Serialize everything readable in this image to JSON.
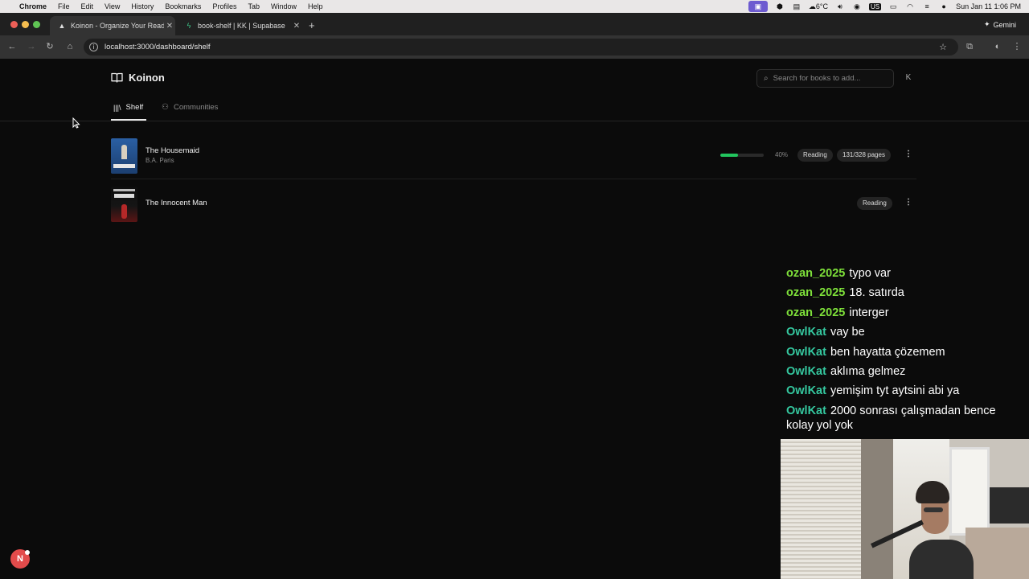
{
  "menubar": {
    "app": "Chrome",
    "items": [
      "File",
      "Edit",
      "View",
      "History",
      "Bookmarks",
      "Profiles",
      "Tab",
      "Window",
      "Help"
    ],
    "weather": "6°C",
    "input_source": "US",
    "datetime": "Sun Jan 11  1:06 PM"
  },
  "browser": {
    "tabs": [
      {
        "title": "Koinon - Organize Your Readi",
        "active": true
      },
      {
        "title": "book-shelf | KK | Supabase",
        "active": false
      }
    ],
    "gemini_label": "Gemini",
    "url": "localhost:3000/dashboard/shelf"
  },
  "app": {
    "brand": "Koinon",
    "search_placeholder": "Search for books to add...",
    "avatar_initial": "K",
    "nav": [
      {
        "label": "Shelf",
        "active": true
      },
      {
        "label": "Communities",
        "active": false
      }
    ]
  },
  "books": [
    {
      "title": "The Housemaid",
      "author": "B.A. Paris",
      "progress": 0.4,
      "percent_label": "40%",
      "status": "Reading",
      "pages_label": "131/328 pages",
      "cover_color": "#1e4f8c"
    },
    {
      "title": "The Innocent Man",
      "author": "",
      "status": "Reading",
      "cover_color": "#1a1a1a"
    }
  ],
  "chat": [
    {
      "user": "ozan_2025",
      "color": "#7ee03a",
      "message": "typo var"
    },
    {
      "user": "ozan_2025",
      "color": "#7ee03a",
      "message": "18. satırda"
    },
    {
      "user": "ozan_2025",
      "color": "#7ee03a",
      "message": "interger"
    },
    {
      "user": "OwlKat",
      "color": "#35c9a0",
      "message": "vay be"
    },
    {
      "user": "OwlKat",
      "color": "#35c9a0",
      "message": "ben hayatta çözemem"
    },
    {
      "user": "OwlKat",
      "color": "#35c9a0",
      "message": "aklıma gelmez"
    },
    {
      "user": "OwlKat",
      "color": "#35c9a0",
      "message": "yemişim tyt aytsini abi ya"
    },
    {
      "user": "OwlKat",
      "color": "#35c9a0",
      "message": "2000 sonrası çalışmadan bence kolay yol yok"
    }
  ],
  "badge_letter": "N"
}
